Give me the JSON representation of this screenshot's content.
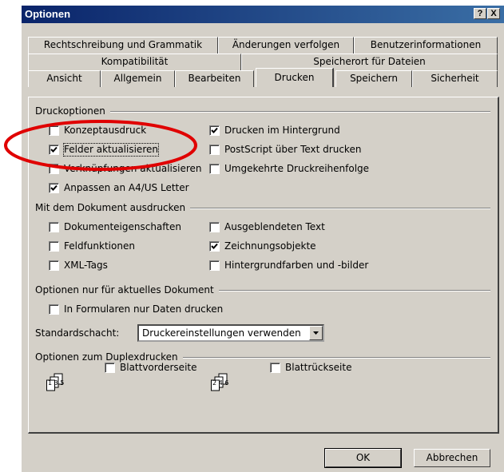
{
  "window": {
    "title": "Optionen",
    "help_label": "?",
    "close_label": "X"
  },
  "tabs": {
    "row1": [
      "Rechtschreibung und Grammatik",
      "Änderungen verfolgen",
      "Benutzerinformationen"
    ],
    "row2": [
      "Kompatibilität",
      "Speicherort für Dateien"
    ],
    "row3": [
      "Ansicht",
      "Allgemein",
      "Bearbeiten",
      "Drucken",
      "Speichern",
      "Sicherheit"
    ],
    "active": "Drucken"
  },
  "groups": {
    "druckoptionen": "Druckoptionen",
    "mit_dokument": "Mit dem Dokument ausdrucken",
    "aktuelles_dokument": "Optionen nur für aktuelles Dokument",
    "duplex": "Optionen zum Duplexdrucken"
  },
  "checkboxes": {
    "konzeptausdruck": {
      "label": "Konzeptausdruck",
      "checked": false
    },
    "felder_aktualisieren": {
      "label": "Felder aktualisieren",
      "checked": true
    },
    "verknuepfungen": {
      "label": "Verknüpfungen aktualisieren",
      "checked": false
    },
    "anpassen_a4": {
      "label": "Anpassen an A4/US Letter",
      "checked": true
    },
    "drucken_hintergrund": {
      "label": "Drucken im Hintergrund",
      "checked": true
    },
    "postscript": {
      "label": "PostScript über Text drucken",
      "checked": false
    },
    "umgekehrt": {
      "label": "Umgekehrte Druckreihenfolge",
      "checked": false
    },
    "dokumenteigenschaften": {
      "label": "Dokumenteigenschaften",
      "checked": false
    },
    "feldfunktionen": {
      "label": "Feldfunktionen",
      "checked": false
    },
    "xml_tags": {
      "label": "XML-Tags",
      "checked": false
    },
    "ausgeblendeter_text": {
      "label": "Ausgeblendeten Text",
      "checked": false
    },
    "zeichnungsobjekte": {
      "label": "Zeichnungsobjekte",
      "checked": true
    },
    "hintergrundfarben": {
      "label": "Hintergrundfarben und -bilder",
      "checked": false
    },
    "formulare_daten": {
      "label": "In Formularen nur Daten drucken",
      "checked": false
    },
    "blattvorderseite": {
      "label": "Blattvorderseite",
      "checked": false
    },
    "blattrueckseite": {
      "label": "Blattrückseite",
      "checked": false
    }
  },
  "standardschacht": {
    "label": "Standardschacht:",
    "value": "Druckereinstellungen verwenden"
  },
  "duplex_icons": {
    "front": "1 3 5",
    "back": "2 4 6"
  },
  "buttons": {
    "ok": "OK",
    "cancel": "Abbrechen"
  },
  "colors": {
    "highlight_ellipse": "#e00000",
    "titlebar": "#0a246a",
    "dialog_bg": "#d4d0c8"
  }
}
